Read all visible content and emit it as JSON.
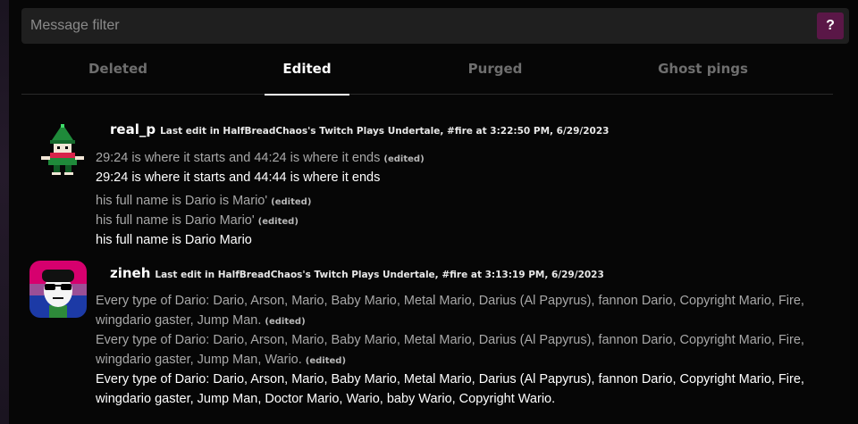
{
  "filter": {
    "placeholder": "Message filter",
    "help_label": "?"
  },
  "tabs": [
    {
      "label": "Deleted",
      "active": false
    },
    {
      "label": "Edited",
      "active": true
    },
    {
      "label": "Purged",
      "active": false
    },
    {
      "label": "Ghost pings",
      "active": false
    }
  ],
  "edited_tag": "(edited)",
  "entries": [
    {
      "username": "real_p",
      "meta": "Last edit in HalfBreadChaos's Twitch Plays Undertale, #fire at 3:22:50 PM, 6/29/2023",
      "avatar_icon": "ralsei-pixel-avatar",
      "groups": [
        {
          "old": [
            "29:24 is where it starts and 44:24 is where it ends"
          ],
          "current": "29:24 is where it starts and 44:44 is where it ends"
        },
        {
          "old": [
            "his full name is Dario is Mario'",
            "his full name is Dario Mario'"
          ],
          "current": "his full name is Dario Mario"
        }
      ]
    },
    {
      "username": "zineh",
      "meta": "Last edit in HalfBreadChaos's Twitch Plays Undertale, #fire at 3:13:19 PM, 6/29/2023",
      "avatar_icon": "sunglasses-bi-flag-avatar",
      "groups": [
        {
          "old": [
            "Every type of Dario: Dario, Arson, Mario, Baby Mario, Metal Mario, Darius (Al Papyrus), fannon Dario, Copyright Mario, Fire, wingdario gaster, Jump Man.",
            "Every type of Dario: Dario, Arson, Mario, Baby Mario, Metal Mario, Darius (Al Papyrus), fannon Dario, Copyright Mario, Fire, wingdario gaster, Jump Man, Wario."
          ],
          "current": "Every type of Dario: Dario, Arson, Mario, Baby Mario, Metal Mario, Darius (Al Papyrus), fannon Dario, Copyright Mario, Fire, wingdario gaster, Jump Man, Doctor Mario, Wario, baby Wario, Copyright Wario."
        }
      ]
    }
  ],
  "colors": {
    "accent": "#5a1747",
    "background": "#000000",
    "input_bg": "#1f1f1f",
    "muted_text": "#a8a8a8"
  }
}
